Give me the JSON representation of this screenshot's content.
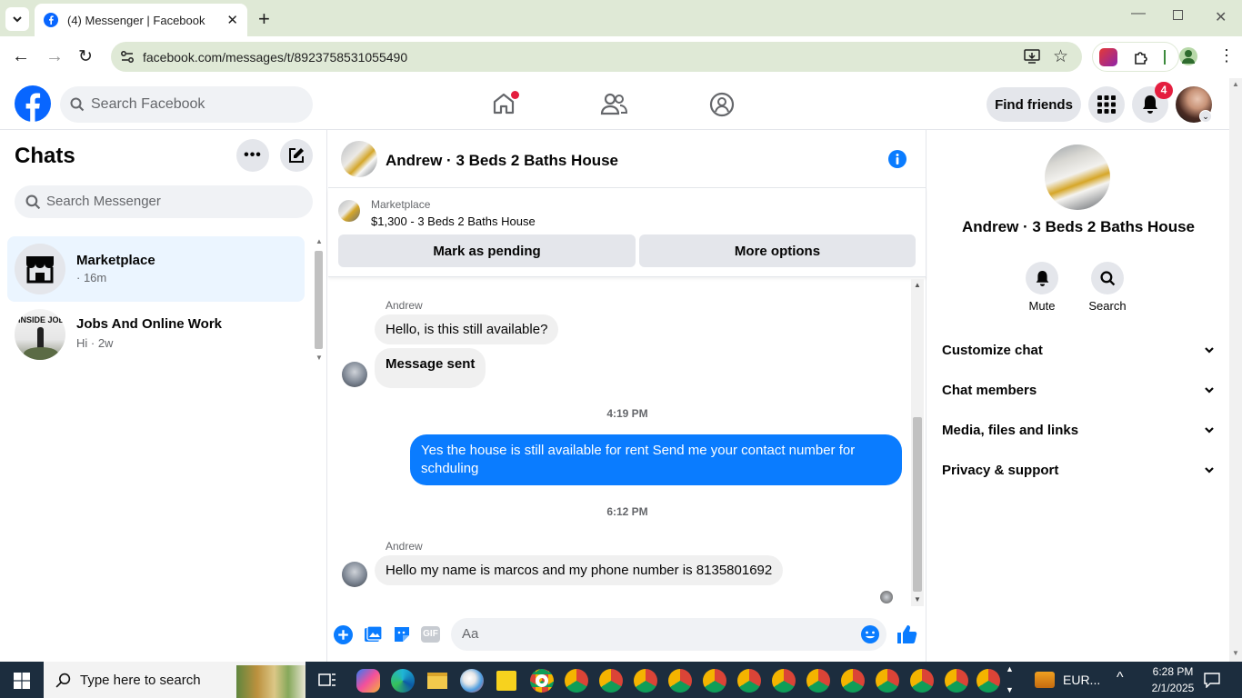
{
  "browser": {
    "tab_title": "(4) Messenger | Facebook",
    "url": "facebook.com/messages/t/8923758531055490"
  },
  "header": {
    "search_placeholder": "Search Facebook",
    "find_friends": "Find friends",
    "notification_count": "4"
  },
  "left": {
    "title": "Chats",
    "search_placeholder": "Search Messenger",
    "chats": [
      {
        "name": "Marketplace",
        "sub": "· 16m"
      },
      {
        "name": "Jobs And Online Work",
        "sub": "Hi · 2w",
        "avatar_text": "INSIDE JOB"
      }
    ]
  },
  "conversation": {
    "title": "Andrew · 3 Beds 2 Baths House",
    "listing_source": "Marketplace",
    "listing_title": "$1,300 - 3 Beds 2 Baths House",
    "mark_pending": "Mark as pending",
    "more_options": "More options",
    "messages": [
      {
        "sender": "Andrew",
        "text": "Hello, is this still available?"
      },
      {
        "text": "Message sent"
      },
      {
        "time": "4:19 PM"
      },
      {
        "text": "Yes the house is still available for rent Send me your contact number for schduling"
      },
      {
        "time": "6:12 PM"
      },
      {
        "sender": "Andrew",
        "text": "Hello my name is marcos and my phone number is 8135801692"
      }
    ],
    "composer_placeholder": "Aa"
  },
  "right": {
    "name": "Andrew · 3 Beds 2 Baths House",
    "actions": {
      "mute": "Mute",
      "search": "Search"
    },
    "sections": [
      "Customize chat",
      "Chat members",
      "Media, files and links",
      "Privacy & support"
    ]
  },
  "taskbar": {
    "search_placeholder": "Type here to search",
    "currency": "EUR...",
    "time": "6:28 PM",
    "date": "2/1/2025"
  },
  "colors": {
    "fb_blue": "#0866ff",
    "messenger_blue": "#0a7cff",
    "chrome_green": "#dfe9d6",
    "notif_red": "#e41e3f"
  }
}
